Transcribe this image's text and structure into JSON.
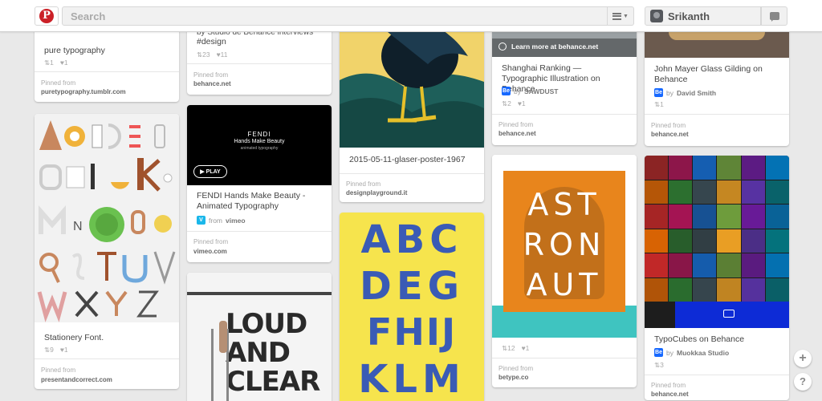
{
  "header": {
    "search_placeholder": "Search",
    "username": "Srikanth",
    "icons": {
      "logo": "pinterest-logo",
      "menu": "hamburger-icon",
      "notifications": "speech-bubble-icon"
    }
  },
  "pins": {
    "typography": {
      "description": "pure typography",
      "repins": "1",
      "likes": "1",
      "pinned_from": "Pinned from",
      "domain": "puretypography.tumblr.com"
    },
    "design": {
      "description_partial": "by Studio de Behance interviews",
      "description": "#design",
      "repins": "23",
      "likes": "11",
      "pinned_from": "Pinned from",
      "domain": "behance.net"
    },
    "shanghai": {
      "overlay": "Learn more at behance.net",
      "description": "Shanghai Ranking — Typographic Illustration on Behance",
      "by": "by",
      "author": "SAWDUST",
      "repins": "2",
      "likes": "1",
      "pinned_from": "Pinned from",
      "domain": "behance.net"
    },
    "mayer": {
      "description": "John Mayer Glass Gilding on Behance",
      "by": "by",
      "author": "David Smith",
      "repins": "1",
      "pinned_from": "Pinned from",
      "domain": "behance.net"
    },
    "stationery": {
      "letters": [
        "A",
        "B",
        "C",
        "D",
        "E",
        "F",
        "G",
        "H",
        "I",
        "J",
        "K",
        "L",
        "M",
        "N",
        "O",
        "P",
        "Q",
        "R",
        "S",
        "T",
        "U",
        "V",
        "W",
        "X",
        "Y",
        "Z"
      ],
      "description": "Stationery Font.",
      "repins": "9",
      "likes": "1",
      "pinned_from": "Pinned from",
      "domain": "presentandcorrect.com"
    },
    "fendi": {
      "video_title": "FENDI",
      "video_line2": "Hands Make Beauty",
      "video_line3": "animated typography",
      "play": "PLAY",
      "description": "FENDI Hands Make Beauty - Animated Typography",
      "from": "from",
      "source": "vimeo",
      "pinned_from": "Pinned from",
      "domain": "vimeo.com"
    },
    "glaser": {
      "description": "2015-05-11-glaser-poster-1967",
      "pinned_from": "Pinned from",
      "domain": "designplayground.it"
    },
    "astronaut": {
      "letters": [
        "A",
        "S",
        "T",
        "R",
        "O",
        "N",
        "A",
        "U",
        "T"
      ],
      "repins": "12",
      "likes": "1",
      "pinned_from": "Pinned from",
      "domain": "betype.co"
    },
    "typocubes": {
      "description": "TypoCubes on Behance",
      "by": "by",
      "author": "Muokkaa Studio",
      "repins": "3",
      "pinned_from": "Pinned from",
      "domain": "behance.net"
    },
    "loud": {
      "line1": "LOUD",
      "line2": "AND",
      "line3": "CLEAR"
    },
    "abc": {
      "lines": [
        "ABC",
        "DEG",
        "FHIJ",
        "KLM"
      ]
    }
  },
  "fab": {
    "add": "+",
    "help": "?"
  },
  "colors": {
    "pinterest_red": "#cb2027",
    "behance_blue": "#1769ff",
    "vimeo_blue": "#1ab7ea"
  }
}
